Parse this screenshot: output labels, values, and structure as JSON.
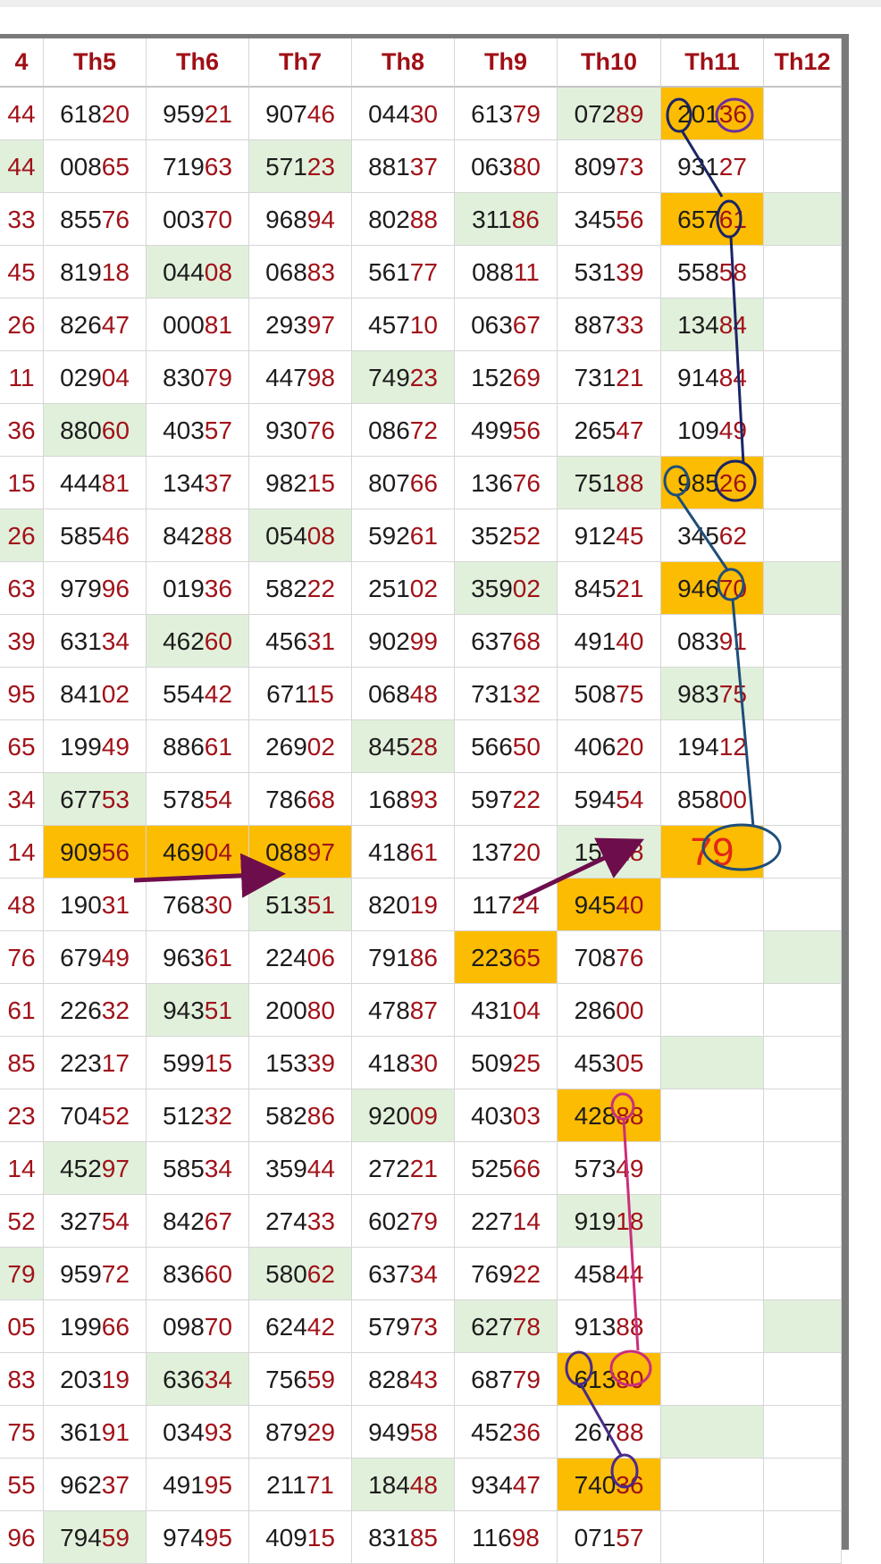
{
  "headers": [
    "4",
    "Th5",
    "Th6",
    "Th7",
    "Th8",
    "Th9",
    "Th10",
    "Th11",
    "Th12"
  ],
  "colors": {
    "green": "#e1f0db",
    "orange": "#fcbc02",
    "header_text": "#a00f16",
    "tail_text": "#a11219"
  },
  "rows": [
    [
      "44",
      "61820",
      "95921",
      "90746",
      "04430",
      "61379",
      "07289",
      "20136",
      ""
    ],
    [
      "44",
      "00865",
      "71963",
      "57123",
      "88137",
      "06380",
      "80973",
      "93127",
      ""
    ],
    [
      "33",
      "85576",
      "00370",
      "96894",
      "80288",
      "31186",
      "34556",
      "65761",
      ""
    ],
    [
      "45",
      "81918",
      "04408",
      "06883",
      "56177",
      "08811",
      "53139",
      "55858",
      ""
    ],
    [
      "26",
      "82647",
      "00081",
      "29397",
      "45710",
      "06367",
      "88733",
      "13484",
      ""
    ],
    [
      "11",
      "02904",
      "83079",
      "44798",
      "74923",
      "15269",
      "73121",
      "91484",
      ""
    ],
    [
      "36",
      "88060",
      "40357",
      "93076",
      "08672",
      "49956",
      "26547",
      "10949",
      ""
    ],
    [
      "15",
      "44481",
      "13437",
      "98215",
      "80766",
      "13676",
      "75188",
      "98526",
      ""
    ],
    [
      "26",
      "58546",
      "84288",
      "05408",
      "59261",
      "35252",
      "91245",
      "34562",
      ""
    ],
    [
      "63",
      "97996",
      "01936",
      "58222",
      "25102",
      "35902",
      "84521",
      "94670",
      ""
    ],
    [
      "39",
      "63134",
      "46260",
      "45631",
      "90299",
      "63768",
      "49140",
      "08391",
      ""
    ],
    [
      "95",
      "84102",
      "55442",
      "67115",
      "06848",
      "73132",
      "50875",
      "98375",
      ""
    ],
    [
      "65",
      "19949",
      "88661",
      "26902",
      "84528",
      "56650",
      "40620",
      "19412",
      ""
    ],
    [
      "34",
      "67753",
      "57854",
      "78668",
      "16893",
      "59722",
      "59454",
      "85800",
      ""
    ],
    [
      "14",
      "90956",
      "46904",
      "08897",
      "41861",
      "13720",
      "15018",
      "79",
      ""
    ],
    [
      "48",
      "19031",
      "76830",
      "51351",
      "82019",
      "11724",
      "94540",
      "",
      ""
    ],
    [
      "76",
      "67949",
      "96361",
      "22406",
      "79186",
      "22365",
      "70876",
      "",
      ""
    ],
    [
      "61",
      "22632",
      "94351",
      "20080",
      "47887",
      "43104",
      "28600",
      "",
      ""
    ],
    [
      "85",
      "22317",
      "59915",
      "15339",
      "41830",
      "50925",
      "45305",
      "",
      ""
    ],
    [
      "23",
      "70452",
      "51232",
      "58286",
      "92009",
      "40303",
      "42888",
      "",
      ""
    ],
    [
      "14",
      "45297",
      "58534",
      "35944",
      "27221",
      "52566",
      "57349",
      "",
      ""
    ],
    [
      "52",
      "32754",
      "84267",
      "27433",
      "60279",
      "22714",
      "91918",
      "",
      ""
    ],
    [
      "79",
      "95972",
      "83660",
      "58062",
      "63734",
      "76922",
      "45844",
      "",
      ""
    ],
    [
      "05",
      "19966",
      "09870",
      "62442",
      "57973",
      "62778",
      "91388",
      "",
      ""
    ],
    [
      "83",
      "20319",
      "63634",
      "75659",
      "82843",
      "68779",
      "61380",
      "",
      ""
    ],
    [
      "75",
      "36191",
      "03493",
      "87929",
      "94958",
      "45236",
      "26788",
      "",
      ""
    ],
    [
      "55",
      "96237",
      "49195",
      "21171",
      "18448",
      "93447",
      "74036",
      "",
      ""
    ],
    [
      "96",
      "79459",
      "97495",
      "40915",
      "83185",
      "11698",
      "07157",
      "",
      ""
    ]
  ],
  "highlights": {
    "green": [
      [
        0,
        6
      ],
      [
        1,
        0
      ],
      [
        1,
        3
      ],
      [
        2,
        5
      ],
      [
        2,
        8
      ],
      [
        3,
        2
      ],
      [
        4,
        7
      ],
      [
        5,
        4
      ],
      [
        6,
        1
      ],
      [
        7,
        6
      ],
      [
        8,
        0
      ],
      [
        8,
        3
      ],
      [
        9,
        5
      ],
      [
        9,
        8
      ],
      [
        10,
        2
      ],
      [
        11,
        7
      ],
      [
        12,
        4
      ],
      [
        13,
        1
      ],
      [
        14,
        6
      ],
      [
        15,
        3
      ],
      [
        16,
        8
      ],
      [
        17,
        2
      ],
      [
        18,
        7
      ],
      [
        19,
        4
      ],
      [
        20,
        1
      ],
      [
        21,
        6
      ],
      [
        22,
        0
      ],
      [
        22,
        3
      ],
      [
        23,
        5
      ],
      [
        23,
        8
      ],
      [
        24,
        2
      ],
      [
        25,
        7
      ],
      [
        26,
        4
      ],
      [
        27,
        1
      ]
    ],
    "orange": [
      [
        0,
        7
      ],
      [
        2,
        7
      ],
      [
        7,
        7
      ],
      [
        9,
        7
      ],
      [
        14,
        1
      ],
      [
        14,
        2
      ],
      [
        14,
        3
      ],
      [
        14,
        7
      ],
      [
        15,
        6
      ],
      [
        16,
        5
      ],
      [
        19,
        6
      ],
      [
        24,
        6
      ],
      [
        26,
        6
      ]
    ],
    "big": [
      [
        14,
        7
      ]
    ]
  }
}
